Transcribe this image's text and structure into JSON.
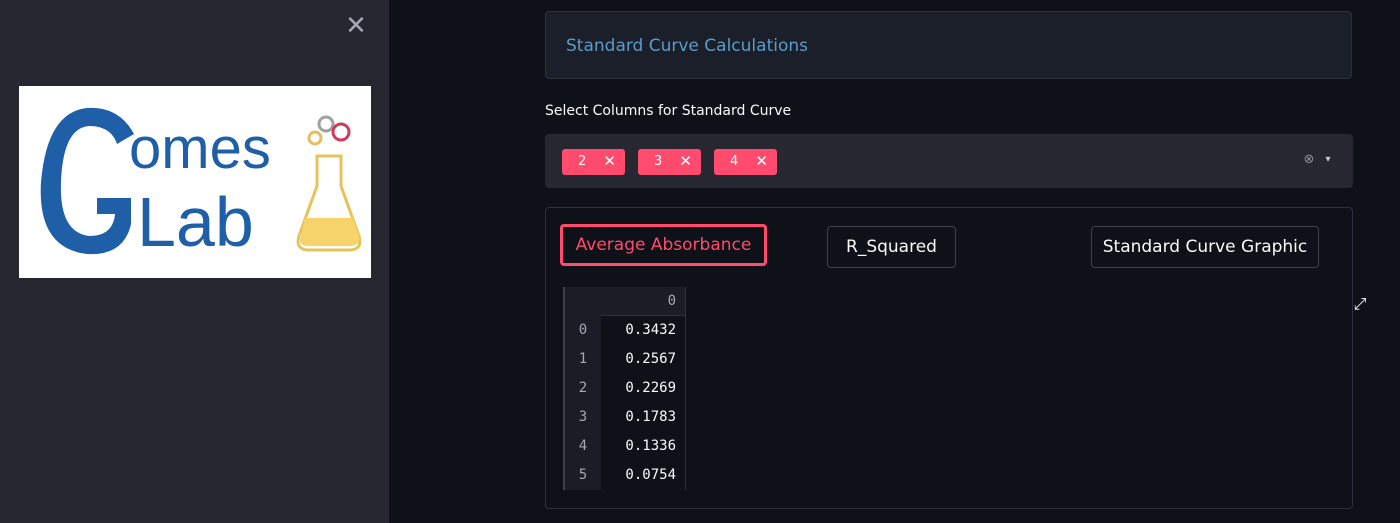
{
  "sidebar": {
    "close_glyph": "✕",
    "logo": {
      "name": "gomes-glab-logo",
      "brand_text": "GomesGLab"
    }
  },
  "main": {
    "info_text": "Standard Curve Calculations",
    "select_label": "Select Columns for Standard Curve",
    "selected_columns": [
      "2",
      "3",
      "4"
    ],
    "chip_remove_glyph": "✕",
    "clear_glyph": "⊗",
    "dropdown_glyph": "▾",
    "tabs": [
      {
        "label": "Average Absorbance",
        "active": true
      },
      {
        "label": "R_Squared",
        "active": false
      },
      {
        "label": "Standard Curve Graphic",
        "active": false
      }
    ],
    "expand_glyph": "⤢",
    "dataframe": {
      "column_header": "0",
      "index": [
        "0",
        "1",
        "2",
        "3",
        "4",
        "5"
      ],
      "values": [
        "0.3432",
        "0.2567",
        "0.2269",
        "0.1783",
        "0.1336",
        "0.0754"
      ]
    }
  },
  "colors": {
    "accent": "#ff4b6e",
    "info_text": "#5d9bc8",
    "logo_blue": "#1f5fa8",
    "flask_liquid": "#f6d36b"
  }
}
